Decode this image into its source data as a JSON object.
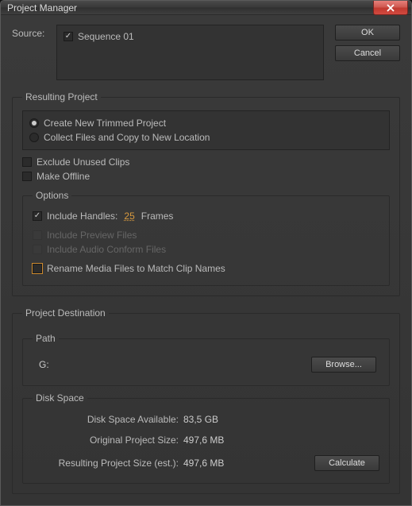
{
  "window": {
    "title": "Project Manager"
  },
  "buttons": {
    "ok": "OK",
    "cancel": "Cancel",
    "browse": "Browse...",
    "calculate": "Calculate"
  },
  "source": {
    "label": "Source:",
    "items": [
      {
        "label": "Sequence 01",
        "checked": true
      }
    ]
  },
  "resulting": {
    "legend": "Resulting Project",
    "radios": {
      "trimmed": "Create New Trimmed Project",
      "collect": "Collect Files and Copy to New Location",
      "selected": "trimmed"
    },
    "exclude": {
      "label": "Exclude Unused Clips",
      "checked": false
    },
    "offline": {
      "label": "Make Offline",
      "checked": false
    },
    "options": {
      "legend": "Options",
      "handles": {
        "checked": true,
        "label_pre": "Include Handles:",
        "value": "25",
        "label_post": "Frames"
      },
      "preview": {
        "checked": false,
        "label": "Include Preview Files",
        "enabled": false
      },
      "audio": {
        "checked": false,
        "label": "Include Audio Conform Files",
        "enabled": false
      },
      "rename": {
        "checked": false,
        "label": "Rename Media Files to Match Clip Names",
        "highlight": true
      }
    }
  },
  "destination": {
    "legend": "Project Destination",
    "path": {
      "legend": "Path",
      "value": "G:"
    },
    "disk": {
      "legend": "Disk Space",
      "avail_label": "Disk Space Available:",
      "avail_value": "83,5 GB",
      "orig_label": "Original Project Size:",
      "orig_value": "497,6 MB",
      "result_label": "Resulting Project Size (est.):",
      "result_value": "497,6 MB"
    }
  }
}
